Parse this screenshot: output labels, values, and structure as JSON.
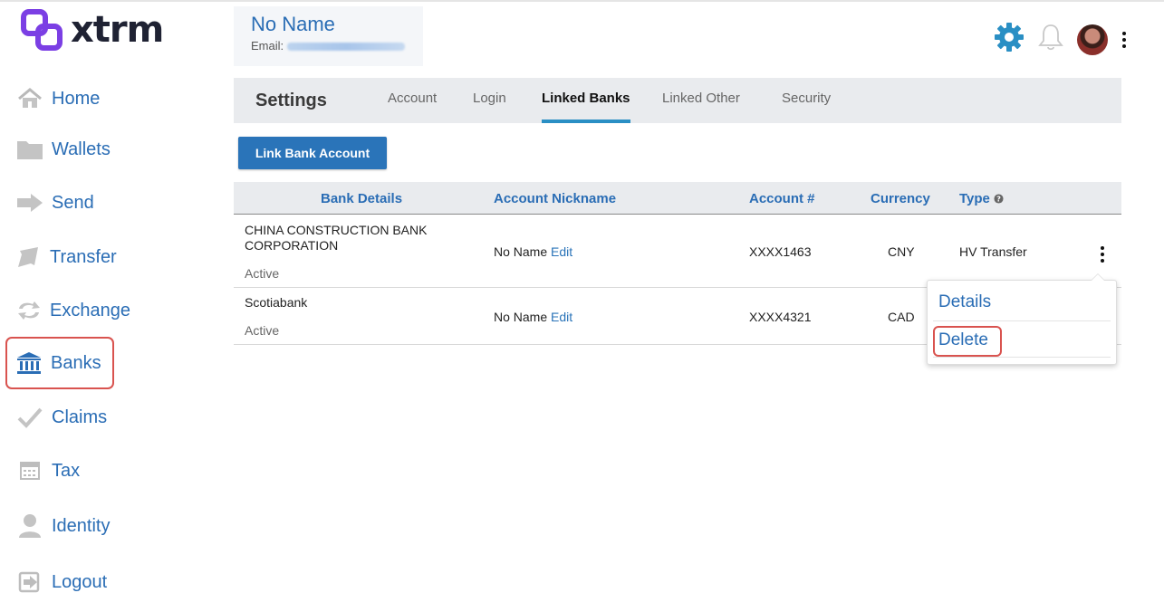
{
  "app": {
    "logo_text": "xtrm",
    "brand_color": "#7b3fe4"
  },
  "user": {
    "name": "No Name",
    "email_label": "Email:"
  },
  "sidebar": {
    "items": [
      {
        "label": "Home",
        "icon": "home-icon"
      },
      {
        "label": "Wallets",
        "icon": "folder-icon"
      },
      {
        "label": "Send",
        "icon": "arrow-right-icon"
      },
      {
        "label": "Transfer",
        "icon": "transfer-icon"
      },
      {
        "label": "Exchange",
        "icon": "exchange-icon"
      },
      {
        "label": "Banks",
        "icon": "bank-icon",
        "active": true
      },
      {
        "label": "Claims",
        "icon": "checkmark-icon"
      },
      {
        "label": "Tax",
        "icon": "calculator-icon"
      },
      {
        "label": "Identity",
        "icon": "person-icon"
      },
      {
        "label": "Logout",
        "icon": "logout-icon"
      }
    ]
  },
  "settings": {
    "title": "Settings",
    "tabs": [
      {
        "label": "Account"
      },
      {
        "label": "Login"
      },
      {
        "label": "Linked Banks",
        "active": true
      },
      {
        "label": "Linked Other"
      },
      {
        "label": "Security"
      }
    ]
  },
  "link_button": "Link Bank Account",
  "table": {
    "headers": [
      "Bank Details",
      "Account Nickname",
      "Account #",
      "Currency",
      "Type"
    ],
    "rows": [
      {
        "bank_line1": "CHINA CONSTRUCTION BANK",
        "bank_line2": "CORPORATION",
        "status": "Active",
        "nickname": "No Name",
        "edit": "Edit",
        "account": "XXXX1463",
        "currency": "CNY",
        "type": "HV Transfer"
      },
      {
        "bank_line1": "Scotiabank",
        "status": "Active",
        "nickname": "No Name",
        "edit": "Edit",
        "account": "XXXX4321",
        "currency": "CAD",
        "type": ""
      }
    ]
  },
  "dropdown": {
    "items": [
      "Details",
      "Delete"
    ]
  },
  "colors": {
    "accent": "#2a6db5",
    "button": "#2a74b9",
    "highlight": "#d9534f",
    "gear": "#2a8fc4"
  }
}
